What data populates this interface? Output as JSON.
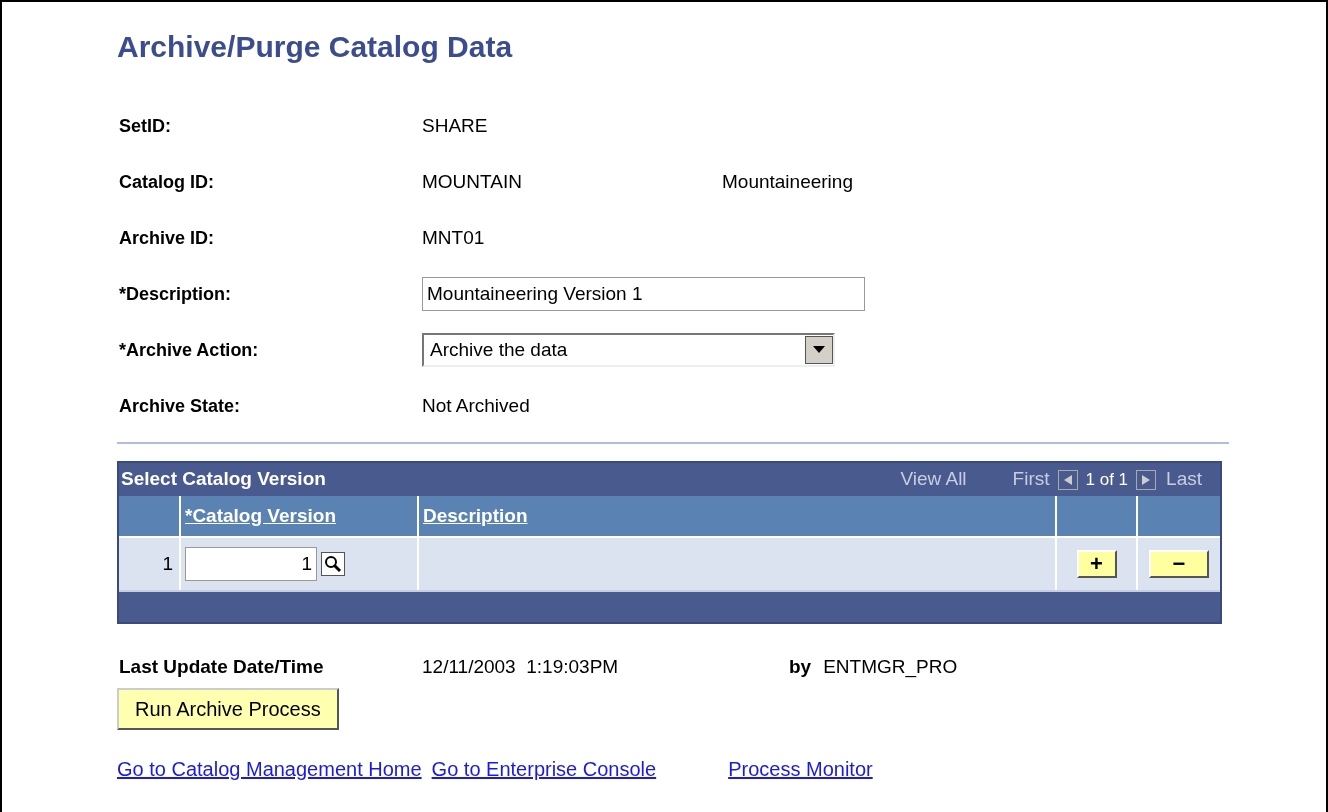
{
  "title": "Archive/Purge Catalog Data",
  "fields": [
    {
      "kind": "text",
      "label": "SetID:",
      "value": "SHARE"
    },
    {
      "kind": "text",
      "label": "Catalog ID:",
      "value": "MOUNTAIN",
      "extra": "Mountaineering"
    },
    {
      "kind": "text",
      "label": "Archive ID:",
      "value": "MNT01"
    },
    {
      "kind": "input",
      "label": "*Description:",
      "value": "Mountaineering Version 1"
    },
    {
      "kind": "select",
      "label": "*Archive Action:",
      "value": "Archive the data"
    },
    {
      "kind": "text",
      "label": "Archive State:",
      "value": "Not Archived"
    }
  ],
  "grid": {
    "title": "Select Catalog Version",
    "view_all": "View All",
    "first": "First",
    "count": "1 of 1",
    "last": "Last",
    "columns": [
      "*Catalog Version",
      "Description"
    ],
    "rows": [
      {
        "number": "1",
        "catalog_version": "1"
      }
    ],
    "add_button": "+",
    "delete_button": "−"
  },
  "last_update": {
    "label": "Last Update Date/Time",
    "value": "12/11/2003  1:19:03PM",
    "by_label": "by",
    "by_value": "ENTMGR_PRO"
  },
  "run_button": "Run Archive Process",
  "links": [
    "Go to Catalog Management Home",
    "Go to Enterprise Console",
    "Process Monitor"
  ]
}
